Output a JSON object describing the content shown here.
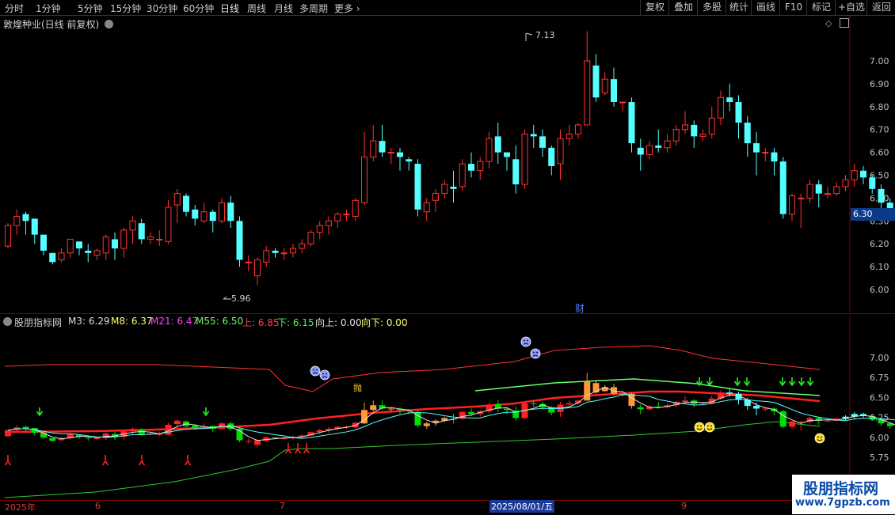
{
  "toolbar": {
    "periods": [
      "分时",
      "1分钟",
      "5分钟",
      "15分钟",
      "30分钟",
      "60分钟",
      "日线",
      "周线",
      "月线",
      "多周期",
      "更多"
    ],
    "active_period": "日线",
    "right_buttons": [
      "复权",
      "叠加",
      "多股",
      "统计",
      "画线",
      "F10",
      "标记",
      "+自选",
      "返回"
    ]
  },
  "main": {
    "title": "敦煌种业(日线 前复权)",
    "high_label": "7.13",
    "low_label": "5.96",
    "current_price": "6.30",
    "news_marker": "财",
    "y_ticks": [
      "7.00",
      "6.90",
      "6.80",
      "6.70",
      "6.60",
      "6.50",
      "6.40",
      "6.30",
      "6.20",
      "6.10",
      "6.00"
    ]
  },
  "indicator": {
    "name": "股朋指标网",
    "legend": [
      {
        "label": "M3: 6.29",
        "color": "#e0e0e0"
      },
      {
        "label": "M8: 6.37",
        "color": "#ffff66"
      },
      {
        "label": "M21: 6.47",
        "color": "#ff44ff"
      },
      {
        "label": "M55: 6.50",
        "color": "#66ff66"
      },
      {
        "label": "上: 6.85",
        "color": "#ff4444"
      },
      {
        "label": "下: 6.15",
        "color": "#44ff44"
      },
      {
        "label": "向上: 0.00",
        "color": "#e0e0e0"
      },
      {
        "label": "向下: 0.00",
        "color": "#ffff66"
      }
    ],
    "y_ticks": [
      "7.00",
      "6.75",
      "6.50",
      "6.25",
      "6.00",
      "5.75"
    ],
    "tag": "抛"
  },
  "time_axis": {
    "labels": [
      "2025年",
      "6",
      "7",
      "2025/08/01/五",
      "9"
    ]
  },
  "watermark": {
    "title": "股朋指标网",
    "url": "www.7gpzb.com"
  },
  "colors": {
    "up": "#ff3232",
    "down": "#54ffff",
    "upper_band": "#ff3232",
    "lower_band": "#32c832"
  },
  "candles": [
    [
      6.19,
      6.29,
      6.28,
      6.18
    ],
    [
      6.28,
      6.35,
      6.32,
      6.24
    ],
    [
      6.33,
      6.34,
      6.3,
      6.24
    ],
    [
      6.31,
      6.31,
      6.24,
      6.2
    ],
    [
      6.24,
      6.24,
      6.17,
      6.15
    ],
    [
      6.16,
      6.16,
      6.12,
      6.11
    ],
    [
      6.13,
      6.18,
      6.16,
      6.12
    ],
    [
      6.16,
      6.22,
      6.22,
      6.14
    ],
    [
      6.21,
      6.21,
      6.18,
      6.15
    ],
    [
      6.17,
      6.2,
      6.16,
      6.12
    ],
    [
      6.15,
      6.18,
      6.17,
      6.13
    ],
    [
      6.16,
      6.24,
      6.23,
      6.13
    ],
    [
      6.22,
      6.25,
      6.18,
      6.13
    ],
    [
      6.18,
      6.27,
      6.26,
      6.14
    ],
    [
      6.26,
      6.32,
      6.3,
      6.2
    ],
    [
      6.29,
      6.31,
      6.22,
      6.2
    ],
    [
      6.22,
      6.25,
      6.23,
      6.2
    ],
    [
      6.22,
      6.26,
      6.22,
      6.19
    ],
    [
      6.21,
      6.39,
      6.36,
      6.2
    ],
    [
      6.37,
      6.44,
      6.42,
      6.29
    ],
    [
      6.41,
      6.42,
      6.34,
      6.32
    ],
    [
      6.35,
      6.37,
      6.31,
      6.28
    ],
    [
      6.3,
      6.38,
      6.34,
      6.29
    ],
    [
      6.34,
      6.35,
      6.3,
      6.25
    ],
    [
      6.3,
      6.4,
      6.38,
      6.29
    ],
    [
      6.38,
      6.41,
      6.3,
      6.27
    ],
    [
      6.3,
      6.32,
      6.13,
      6.1
    ],
    [
      6.12,
      6.15,
      6.12,
      6.08
    ],
    [
      6.06,
      6.14,
      6.13,
      6.02
    ],
    [
      6.12,
      6.19,
      6.17,
      6.1
    ],
    [
      6.17,
      6.18,
      6.16,
      6.14
    ],
    [
      6.16,
      6.18,
      6.16,
      6.13
    ],
    [
      6.16,
      6.2,
      6.18,
      6.14
    ],
    [
      6.18,
      6.22,
      6.2,
      6.16
    ],
    [
      6.2,
      6.26,
      6.25,
      6.19
    ],
    [
      6.25,
      6.3,
      6.28,
      6.22
    ],
    [
      6.28,
      6.32,
      6.3,
      6.24
    ],
    [
      6.3,
      6.34,
      6.33,
      6.27
    ],
    [
      6.33,
      6.35,
      6.33,
      6.3
    ],
    [
      6.32,
      6.4,
      6.39,
      6.3
    ],
    [
      6.38,
      6.69,
      6.58,
      6.37
    ],
    [
      6.58,
      6.72,
      6.65,
      6.56
    ],
    [
      6.65,
      6.72,
      6.6,
      6.58
    ],
    [
      6.6,
      6.62,
      6.6,
      6.55
    ],
    [
      6.6,
      6.62,
      6.58,
      6.52
    ],
    [
      6.57,
      6.58,
      6.56,
      6.52
    ],
    [
      6.55,
      6.57,
      6.35,
      6.32
    ],
    [
      6.34,
      6.4,
      6.38,
      6.3
    ],
    [
      6.39,
      6.44,
      6.42,
      6.34
    ],
    [
      6.42,
      6.48,
      6.46,
      6.4
    ],
    [
      6.45,
      6.52,
      6.44,
      6.38
    ],
    [
      6.45,
      6.57,
      6.55,
      6.43
    ],
    [
      6.55,
      6.6,
      6.52,
      6.49
    ],
    [
      6.52,
      6.58,
      6.56,
      6.48
    ],
    [
      6.56,
      6.69,
      6.66,
      6.53
    ],
    [
      6.67,
      6.73,
      6.6,
      6.55
    ],
    [
      6.6,
      6.6,
      6.58,
      6.52
    ],
    [
      6.57,
      6.63,
      6.46,
      6.42
    ],
    [
      6.46,
      6.7,
      6.68,
      6.44
    ],
    [
      6.68,
      6.72,
      6.67,
      6.62
    ],
    [
      6.67,
      6.7,
      6.62,
      6.58
    ],
    [
      6.62,
      6.63,
      6.54,
      6.5
    ],
    [
      6.55,
      6.7,
      6.66,
      6.48
    ],
    [
      6.66,
      6.72,
      6.68,
      6.63
    ],
    [
      6.68,
      6.73,
      6.72,
      6.66
    ],
    [
      6.72,
      7.13,
      7.0,
      6.72
    ],
    [
      6.98,
      7.03,
      6.84,
      6.82
    ],
    [
      6.86,
      6.95,
      6.92,
      6.85
    ],
    [
      6.92,
      6.97,
      6.82,
      6.8
    ],
    [
      6.82,
      6.82,
      6.82,
      6.78
    ],
    [
      6.82,
      6.84,
      6.64,
      6.6
    ],
    [
      6.62,
      6.66,
      6.59,
      6.52
    ],
    [
      6.59,
      6.65,
      6.63,
      6.57
    ],
    [
      6.63,
      6.7,
      6.62,
      6.6
    ],
    [
      6.62,
      6.68,
      6.65,
      6.6
    ],
    [
      6.65,
      6.72,
      6.7,
      6.63
    ],
    [
      6.7,
      6.78,
      6.72,
      6.68
    ],
    [
      6.72,
      6.74,
      6.67,
      6.62
    ],
    [
      6.67,
      6.7,
      6.68,
      6.65
    ],
    [
      6.68,
      6.8,
      6.75,
      6.66
    ],
    [
      6.75,
      6.87,
      6.84,
      6.72
    ],
    [
      6.84,
      6.9,
      6.82,
      6.78
    ],
    [
      6.82,
      6.85,
      6.73,
      6.66
    ],
    [
      6.73,
      6.76,
      6.64,
      6.58
    ],
    [
      6.64,
      6.69,
      6.6,
      6.5
    ],
    [
      6.6,
      6.62,
      6.6,
      6.56
    ],
    [
      6.6,
      6.62,
      6.56,
      6.5
    ],
    [
      6.56,
      6.58,
      6.33,
      6.31
    ],
    [
      6.33,
      6.42,
      6.41,
      6.3
    ],
    [
      6.4,
      6.42,
      6.4,
      6.27
    ],
    [
      6.4,
      6.48,
      6.46,
      6.38
    ],
    [
      6.46,
      6.48,
      6.42,
      6.36
    ],
    [
      6.42,
      6.45,
      6.42,
      6.4
    ],
    [
      6.42,
      6.47,
      6.45,
      6.41
    ],
    [
      6.45,
      6.5,
      6.48,
      6.43
    ],
    [
      6.48,
      6.55,
      6.52,
      6.45
    ],
    [
      6.52,
      6.54,
      6.49,
      6.46
    ],
    [
      6.49,
      6.5,
      6.44,
      6.42
    ],
    [
      6.44,
      6.46,
      6.38,
      6.34
    ],
    [
      6.38,
      6.4,
      6.34,
      6.3
    ],
    [
      6.34,
      6.36,
      6.3,
      6.18
    ]
  ]
}
